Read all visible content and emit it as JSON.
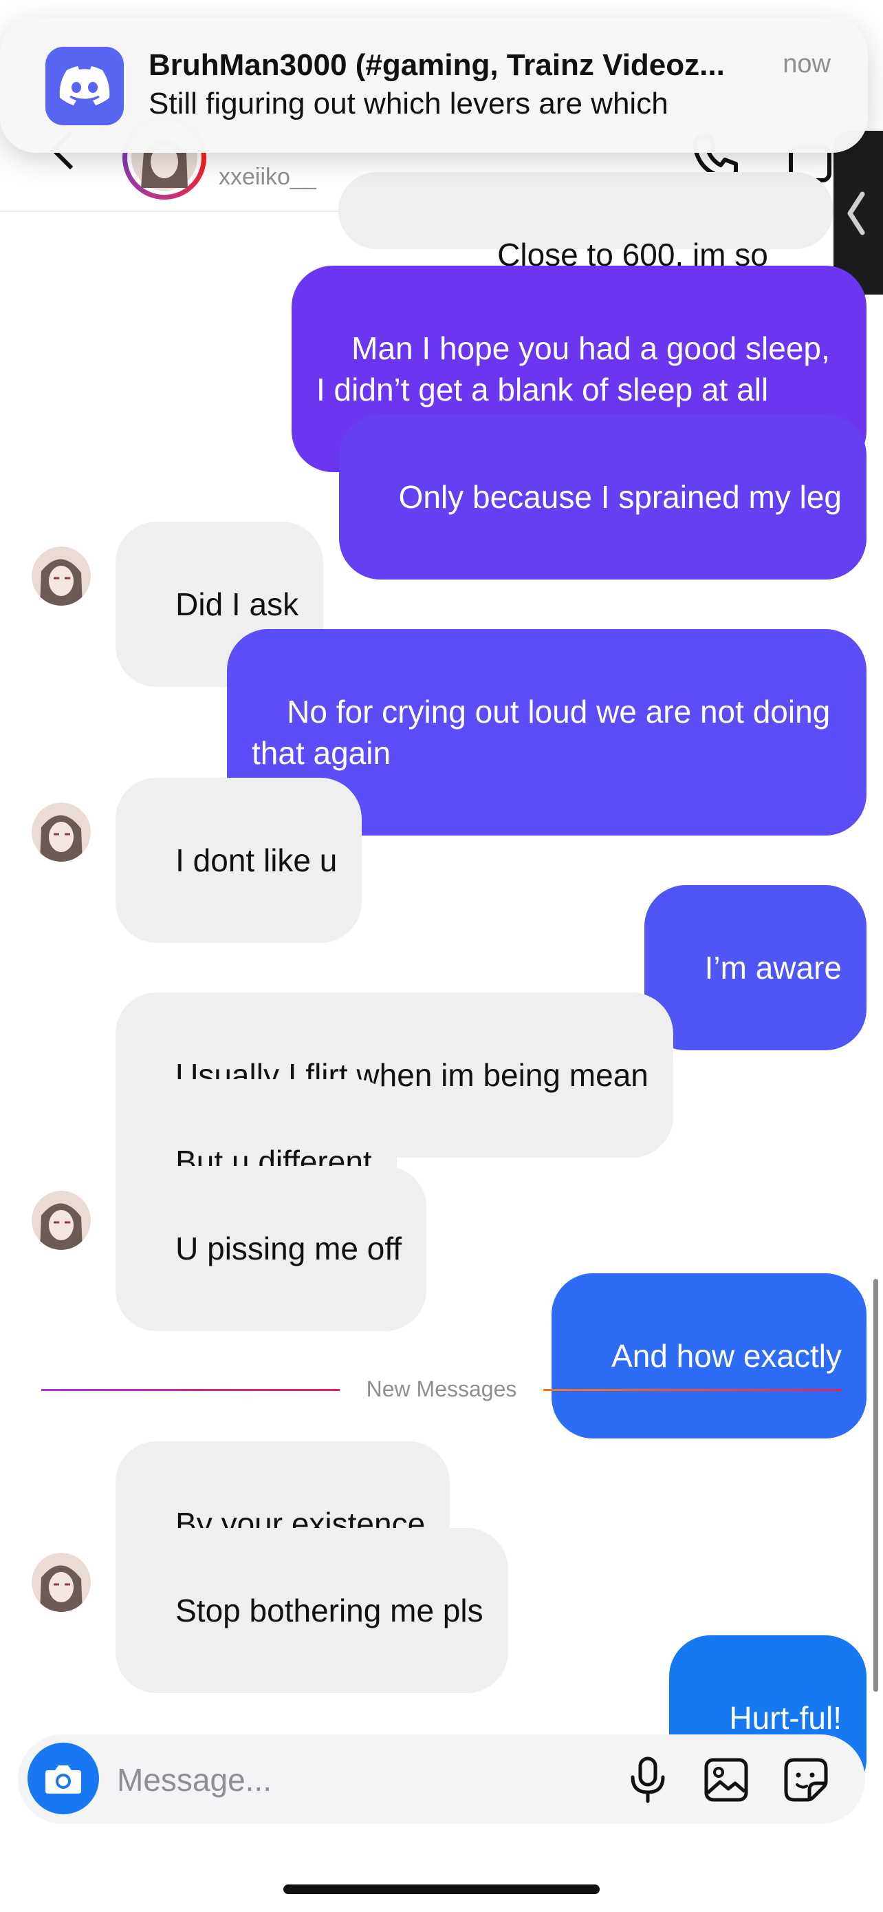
{
  "notification": {
    "app_icon": "discord-icon",
    "title": "BruhMan3000 (#gaming, Trainz Videoz...",
    "time": "now",
    "body": "Still figuring out which levers are which"
  },
  "header": {
    "username": "xxeiiko__",
    "icons": [
      "back-chevron-icon",
      "phone-icon",
      "video-icon"
    ]
  },
  "messages": [
    {
      "dir": "in",
      "text": "Close to 600, im so tired"
    },
    {
      "dir": "out",
      "text": "Man I hope you had a good sleep, I didn’t get a blank of sleep at all",
      "color": "#6a36ef"
    },
    {
      "dir": "out",
      "text": "Only because I sprained my leg",
      "color": "#6440f2"
    },
    {
      "dir": "in",
      "text": "Did I ask"
    },
    {
      "dir": "out",
      "text": "No for crying out loud we are not doing that again",
      "color": "#5b4df7"
    },
    {
      "dir": "in",
      "text": "I dont like u"
    },
    {
      "dir": "out",
      "text": "I’m aware",
      "color": "#4f56f5"
    },
    {
      "dir": "in",
      "text": "Usually I flirt when im being mean"
    },
    {
      "dir": "in",
      "text": "But u different"
    },
    {
      "dir": "in",
      "text": "U pissing me off"
    },
    {
      "dir": "out",
      "text": "And how exactly",
      "color": "#2f6cf5"
    },
    {
      "dir": "in",
      "text": "By your existence"
    },
    {
      "dir": "in",
      "text": "Stop bothering me pls"
    },
    {
      "dir": "out",
      "text": "Hurt-ful!",
      "color": "#1779f2"
    }
  ],
  "divider": {
    "label": "New Messages"
  },
  "composer": {
    "placeholder": "Message...",
    "icons": [
      "camera-icon",
      "microphone-icon",
      "gallery-icon",
      "sticker-icon"
    ]
  },
  "colors": {
    "incoming_bubble": "#efefef",
    "camera_button": "#1877f2",
    "discord": "#5865f2"
  }
}
